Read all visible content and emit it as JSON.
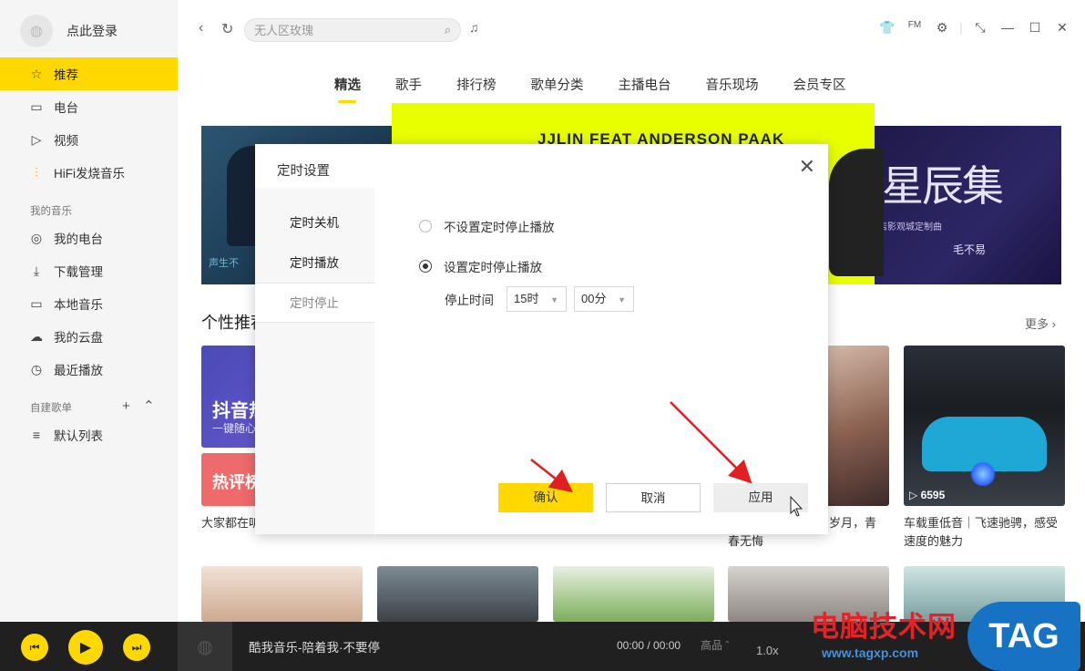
{
  "sidebar": {
    "login_text": "点此登录",
    "items": [
      {
        "label": "推荐",
        "icon": "star-icon",
        "glyph": "☆"
      },
      {
        "label": "电台",
        "icon": "radio-icon",
        "glyph": "▭"
      },
      {
        "label": "视频",
        "icon": "video-icon",
        "glyph": "▷"
      },
      {
        "label": "HiFi发烧音乐",
        "icon": "hifi-wave-icon",
        "glyph": "⫶"
      }
    ],
    "my_music_label": "我的音乐",
    "my_music": [
      {
        "label": "我的电台",
        "icon": "podcast-icon",
        "glyph": "◎"
      },
      {
        "label": "下载管理",
        "icon": "download-icon",
        "glyph": "⤓"
      },
      {
        "label": "本地音乐",
        "icon": "monitor-icon",
        "glyph": "▭"
      },
      {
        "label": "我的云盘",
        "icon": "cloud-icon",
        "glyph": "☁"
      },
      {
        "label": "最近播放",
        "icon": "clock-icon",
        "glyph": "◷"
      }
    ],
    "playlist_label": "自建歌单",
    "default_list": {
      "label": "默认列表",
      "icon": "playlist-icon",
      "glyph": "≡"
    }
  },
  "search": {
    "placeholder": "无人区玫瑰"
  },
  "tabs": [
    "精选",
    "歌手",
    "排行榜",
    "歌单分类",
    "主播电台",
    "音乐现场",
    "会员专区"
  ],
  "banner": {
    "center_headline": "JJLIN  FEAT ANDERSON PAAK",
    "left_caption": "声生不",
    "right_title": "星辰集",
    "right_sub": "店影观城定制曲",
    "right_artist": "毛不易"
  },
  "section": {
    "title": "个性推荐",
    "more": "更多 ›"
  },
  "cards": {
    "c1_title": "抖音热",
    "c1_sub": "一键随心",
    "c1b_title": "热评榜",
    "c1_caption": "大家都在听",
    "c4_caption": "岁月，青春无悔",
    "c5_play_count": "6595",
    "c5_caption": "车载重低音｜飞速驰骋，感受速度的魅力"
  },
  "dialog": {
    "title": "定时设置",
    "side_items": [
      "定时关机",
      "定时播放",
      "定时停止"
    ],
    "option_off": "不设置定时停止播放",
    "option_on": "设置定时停止播放",
    "stop_time_label": "停止时间",
    "hour_value": "15时",
    "minute_value": "00分",
    "confirm": "确认",
    "cancel": "取消",
    "apply": "应用"
  },
  "player": {
    "title": "酷我音乐-陪着我·不要停",
    "time": "00:00 / 00:00",
    "quality": "高品 ˆ",
    "speed": "1.0x"
  },
  "watermark": {
    "text": "电脑技术网",
    "url": "www.tagxp.com",
    "tag": "TAG"
  },
  "colors": {
    "accent": "#ffd800",
    "arrow": "#e02020"
  }
}
